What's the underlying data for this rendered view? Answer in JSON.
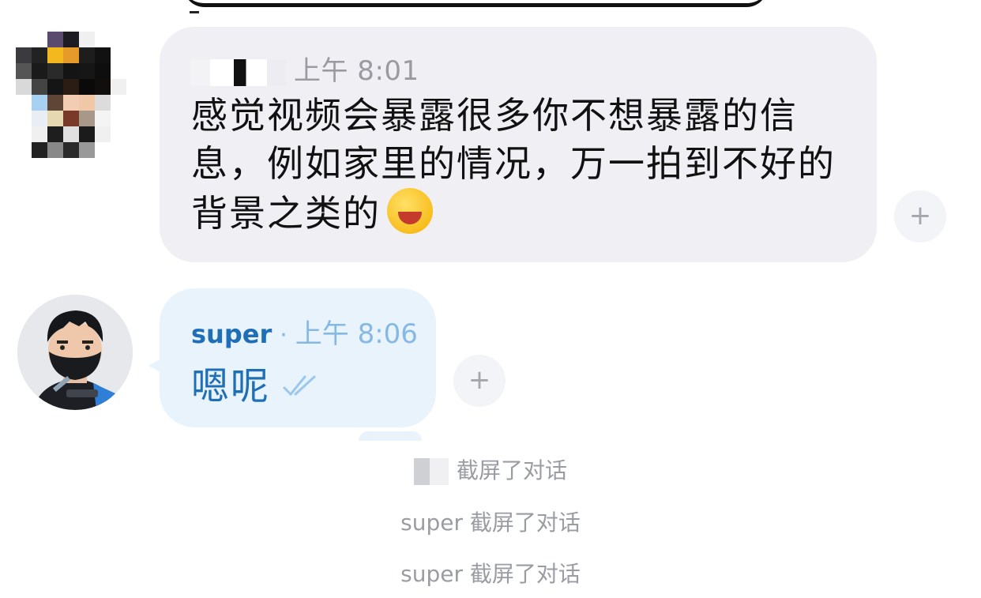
{
  "messages": [
    {
      "sender": "",
      "time": "上午 8:01",
      "text": "感觉视频会暴露很多你不想暴露的信息，例如家里的情况，万一拍到不好的背景之类的",
      "emoji": "rolling-on-floor-laughing-emoji",
      "add_reaction": "+"
    },
    {
      "sender": "super",
      "separator": "·",
      "time": "上午 8:06",
      "text": "嗯呢",
      "status": "read-double-check-icon",
      "add_reaction": "+"
    }
  ],
  "system_events": [
    {
      "actor": "",
      "text": "截屏了对话"
    },
    {
      "actor": "super",
      "text": "截屏了对话"
    },
    {
      "actor": "super",
      "text": "截屏了对话"
    }
  ],
  "colors": {
    "incoming_bubble": "#efeff4",
    "outgoing_bubble": "#e8f3fc",
    "sender_blue": "#1f6fb7",
    "time_blue": "#85b9e4",
    "system_text": "#9a9ca3"
  }
}
